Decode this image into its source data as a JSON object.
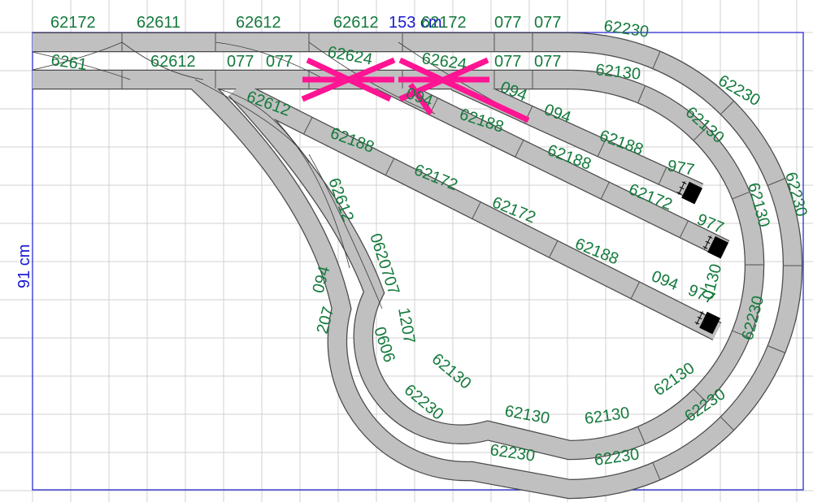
{
  "colors": {
    "grid": "#d0d0d0",
    "board": "#1a1ad0",
    "track": "#c0c0c0",
    "label": "#147a3c",
    "highlight": "#ff1493",
    "bumper": "#000000"
  },
  "dimensions": {
    "width_label": "153 cm",
    "height_label": "91 cm"
  },
  "labels": [
    "62172",
    "62611",
    "62612",
    "62612",
    "62172",
    "077",
    "077",
    "62230",
    "6261",
    "62612",
    "077",
    "077",
    "62624",
    "62624",
    "077",
    "077",
    "62130",
    "62230",
    "62612",
    "094",
    "094",
    "094",
    "62130",
    "62188",
    "62188",
    "62188",
    "62188",
    "977",
    "62230",
    "62172",
    "62172",
    "62130",
    "977",
    "62612",
    "62172",
    "62188",
    "0620707",
    "094",
    "207",
    "1207",
    "094",
    "977",
    "0130",
    "0606",
    "62230",
    "62130",
    "62130",
    "62130",
    "62130",
    "62230",
    "62230",
    "62230",
    "62230"
  ]
}
